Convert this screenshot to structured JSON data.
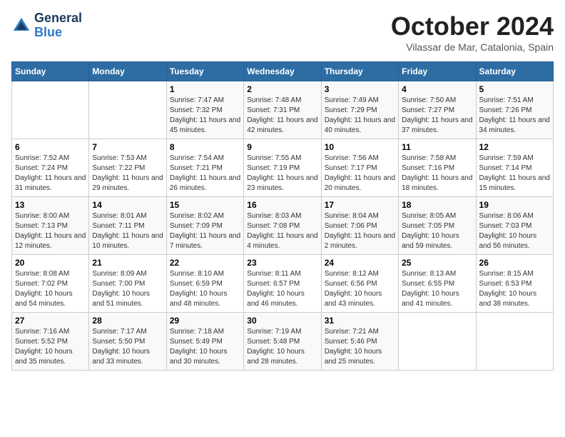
{
  "header": {
    "logo_line1": "General",
    "logo_line2": "Blue",
    "month": "October 2024",
    "location": "Vilassar de Mar, Catalonia, Spain"
  },
  "days_of_week": [
    "Sunday",
    "Monday",
    "Tuesday",
    "Wednesday",
    "Thursday",
    "Friday",
    "Saturday"
  ],
  "weeks": [
    [
      {
        "day": "",
        "info": ""
      },
      {
        "day": "",
        "info": ""
      },
      {
        "day": "1",
        "info": "Sunrise: 7:47 AM\nSunset: 7:32 PM\nDaylight: 11 hours and 45 minutes."
      },
      {
        "day": "2",
        "info": "Sunrise: 7:48 AM\nSunset: 7:31 PM\nDaylight: 11 hours and 42 minutes."
      },
      {
        "day": "3",
        "info": "Sunrise: 7:49 AM\nSunset: 7:29 PM\nDaylight: 11 hours and 40 minutes."
      },
      {
        "day": "4",
        "info": "Sunrise: 7:50 AM\nSunset: 7:27 PM\nDaylight: 11 hours and 37 minutes."
      },
      {
        "day": "5",
        "info": "Sunrise: 7:51 AM\nSunset: 7:26 PM\nDaylight: 11 hours and 34 minutes."
      }
    ],
    [
      {
        "day": "6",
        "info": "Sunrise: 7:52 AM\nSunset: 7:24 PM\nDaylight: 11 hours and 31 minutes."
      },
      {
        "day": "7",
        "info": "Sunrise: 7:53 AM\nSunset: 7:22 PM\nDaylight: 11 hours and 29 minutes."
      },
      {
        "day": "8",
        "info": "Sunrise: 7:54 AM\nSunset: 7:21 PM\nDaylight: 11 hours and 26 minutes."
      },
      {
        "day": "9",
        "info": "Sunrise: 7:55 AM\nSunset: 7:19 PM\nDaylight: 11 hours and 23 minutes."
      },
      {
        "day": "10",
        "info": "Sunrise: 7:56 AM\nSunset: 7:17 PM\nDaylight: 11 hours and 20 minutes."
      },
      {
        "day": "11",
        "info": "Sunrise: 7:58 AM\nSunset: 7:16 PM\nDaylight: 11 hours and 18 minutes."
      },
      {
        "day": "12",
        "info": "Sunrise: 7:59 AM\nSunset: 7:14 PM\nDaylight: 11 hours and 15 minutes."
      }
    ],
    [
      {
        "day": "13",
        "info": "Sunrise: 8:00 AM\nSunset: 7:13 PM\nDaylight: 11 hours and 12 minutes."
      },
      {
        "day": "14",
        "info": "Sunrise: 8:01 AM\nSunset: 7:11 PM\nDaylight: 11 hours and 10 minutes."
      },
      {
        "day": "15",
        "info": "Sunrise: 8:02 AM\nSunset: 7:09 PM\nDaylight: 11 hours and 7 minutes."
      },
      {
        "day": "16",
        "info": "Sunrise: 8:03 AM\nSunset: 7:08 PM\nDaylight: 11 hours and 4 minutes."
      },
      {
        "day": "17",
        "info": "Sunrise: 8:04 AM\nSunset: 7:06 PM\nDaylight: 11 hours and 2 minutes."
      },
      {
        "day": "18",
        "info": "Sunrise: 8:05 AM\nSunset: 7:05 PM\nDaylight: 10 hours and 59 minutes."
      },
      {
        "day": "19",
        "info": "Sunrise: 8:06 AM\nSunset: 7:03 PM\nDaylight: 10 hours and 56 minutes."
      }
    ],
    [
      {
        "day": "20",
        "info": "Sunrise: 8:08 AM\nSunset: 7:02 PM\nDaylight: 10 hours and 54 minutes."
      },
      {
        "day": "21",
        "info": "Sunrise: 8:09 AM\nSunset: 7:00 PM\nDaylight: 10 hours and 51 minutes."
      },
      {
        "day": "22",
        "info": "Sunrise: 8:10 AM\nSunset: 6:59 PM\nDaylight: 10 hours and 48 minutes."
      },
      {
        "day": "23",
        "info": "Sunrise: 8:11 AM\nSunset: 6:57 PM\nDaylight: 10 hours and 46 minutes."
      },
      {
        "day": "24",
        "info": "Sunrise: 8:12 AM\nSunset: 6:56 PM\nDaylight: 10 hours and 43 minutes."
      },
      {
        "day": "25",
        "info": "Sunrise: 8:13 AM\nSunset: 6:55 PM\nDaylight: 10 hours and 41 minutes."
      },
      {
        "day": "26",
        "info": "Sunrise: 8:15 AM\nSunset: 6:53 PM\nDaylight: 10 hours and 38 minutes."
      }
    ],
    [
      {
        "day": "27",
        "info": "Sunrise: 7:16 AM\nSunset: 5:52 PM\nDaylight: 10 hours and 35 minutes."
      },
      {
        "day": "28",
        "info": "Sunrise: 7:17 AM\nSunset: 5:50 PM\nDaylight: 10 hours and 33 minutes."
      },
      {
        "day": "29",
        "info": "Sunrise: 7:18 AM\nSunset: 5:49 PM\nDaylight: 10 hours and 30 minutes."
      },
      {
        "day": "30",
        "info": "Sunrise: 7:19 AM\nSunset: 5:48 PM\nDaylight: 10 hours and 28 minutes."
      },
      {
        "day": "31",
        "info": "Sunrise: 7:21 AM\nSunset: 5:46 PM\nDaylight: 10 hours and 25 minutes."
      },
      {
        "day": "",
        "info": ""
      },
      {
        "day": "",
        "info": ""
      }
    ]
  ]
}
